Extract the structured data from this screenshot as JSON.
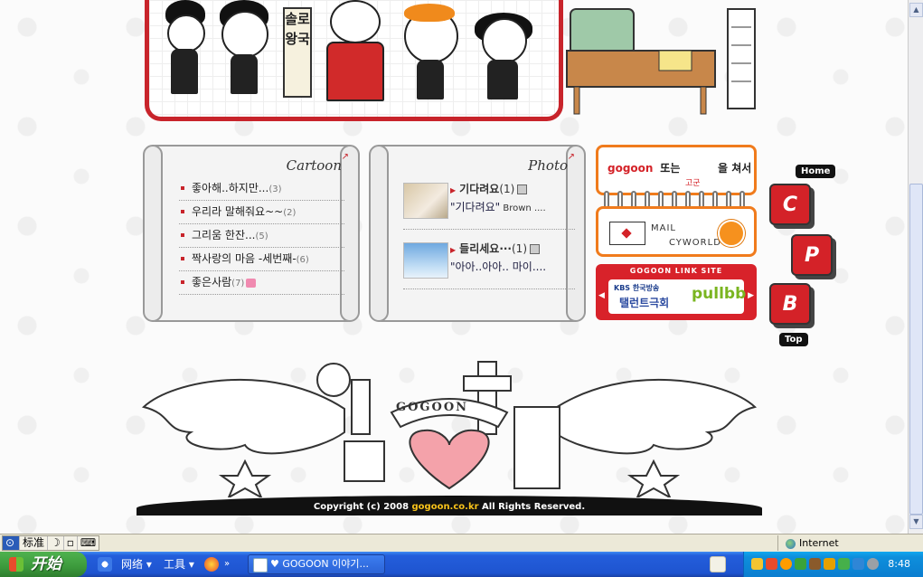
{
  "banner": {
    "sign_text": "솔로왕국"
  },
  "cartoon": {
    "title": "Cartoon",
    "items": [
      {
        "label": "좋아해..하지만...",
        "count": "(3)"
      },
      {
        "label": "우리라 말해줘요~~",
        "count": "(2)"
      },
      {
        "label": "그리움 한잔...",
        "count": "(5)"
      },
      {
        "label": "짝사랑의 마음 -세번째-",
        "count": "(6)"
      },
      {
        "label": "좋은사람",
        "count": "(7)"
      }
    ]
  },
  "photo": {
    "title": "Photo",
    "items": [
      {
        "title": "기다려요",
        "count": "(1)",
        "sub_ko": "\"기다려요\"",
        "sub_en": " Brown ...."
      },
      {
        "title": "들리세요···",
        "count": "(1)",
        "sub_ko": "\"아아..아아.. 마이....",
        "sub_en": ""
      }
    ]
  },
  "search_box": {
    "brand": "gogoon",
    "text": "또는",
    "text2": "을 쳐서",
    "small": "고군"
  },
  "mail_box": {
    "mail_label": "MAIL",
    "cyworld_label": "CYWORLD"
  },
  "link_site": {
    "header": "GOGOON LINK SITE",
    "kbs": "KBS 한국방송",
    "talent": "탤런트극회",
    "pullbb": "pullbb"
  },
  "side_nav": {
    "home": "Home",
    "c": "C",
    "p": "P",
    "b": "B",
    "top": "Top"
  },
  "bottom_art": {
    "ribbon": "GOGOON"
  },
  "footer": {
    "prefix": "Copyright (c) 2008 ",
    "site": "gogoon.co.kr",
    "suffix": " All Rights Reserved."
  },
  "statusbar": {
    "ime_label": "标准",
    "zone": "Internet"
  },
  "taskbar": {
    "start": "开始",
    "network": "网络",
    "tools": "工具",
    "window_title": "♥ GOGOON 이야기...",
    "clock": "8:48"
  },
  "colors": {
    "brand_red": "#c8242b",
    "accent_orange": "#f07b1c",
    "taskbar_blue": "#245edb"
  }
}
